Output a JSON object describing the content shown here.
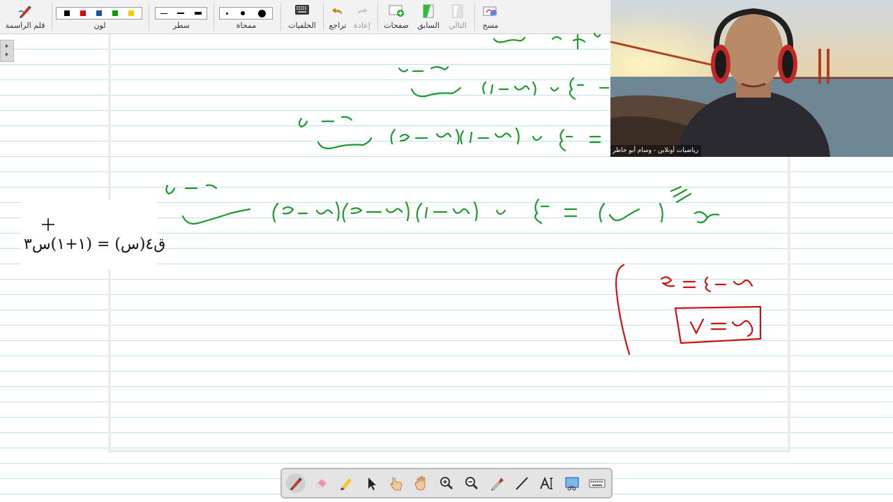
{
  "toolbar": {
    "pen_label": "قلم الراسمة",
    "color_label": "لون",
    "line_label": "سطر",
    "eraser_label": "ممحاة",
    "backgrounds_label": "الخلفيات",
    "undo_label": "تراجع",
    "redo_label": "إعادة",
    "pages_label": "صفحات",
    "previous_label": "السابق",
    "next_label": "التالي",
    "clear_label": "مسح",
    "colors": [
      "#000000",
      "#e00000",
      "#1f4fa0",
      "#00a000",
      "#f0d000"
    ]
  },
  "board": {
    "formula_text": "ق٤(س) = (١+١)س٣"
  },
  "webcam": {
    "caption": "رياضيات أونلاين - وسام أبو خاطر"
  },
  "bottom_tools": [
    "pen",
    "eraser",
    "highlighter",
    "select",
    "pointer-hand",
    "pan-hand",
    "zoom-in",
    "zoom-out",
    "eyedropper",
    "line",
    "text",
    "screen-capture",
    "keyboard"
  ]
}
